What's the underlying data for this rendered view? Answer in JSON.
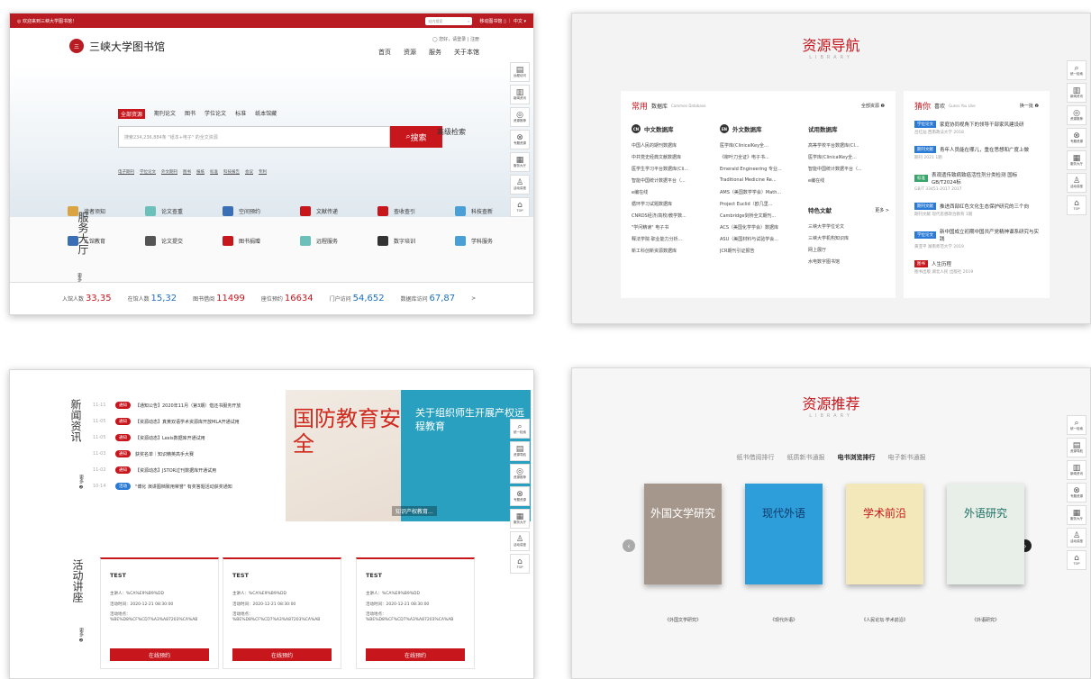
{
  "rail": {
    "p1": [
      {
        "g": "⌕",
        "l": "统一检索",
        "act": true
      },
      {
        "g": "▤",
        "l": "远程访问",
        "act": false
      },
      {
        "g": "▥",
        "l": "新闻资讯",
        "act": false
      },
      {
        "g": "◎",
        "l": "资源推荐",
        "act": false
      },
      {
        "g": "⊗",
        "l": "专题资源",
        "act": false
      },
      {
        "g": "▦",
        "l": "服务大厅",
        "act": false
      },
      {
        "g": "♙",
        "l": "活动讲座",
        "act": false
      },
      {
        "g": "⌂",
        "l": "TOP",
        "act": false
      }
    ],
    "p2": [
      {
        "g": "⌕",
        "l": "统一检索",
        "act": false
      },
      {
        "g": "▤",
        "l": "资源导航",
        "act": true
      },
      {
        "g": "▥",
        "l": "新闻资讯",
        "act": false
      },
      {
        "g": "◎",
        "l": "资源推荐",
        "act": false
      },
      {
        "g": "⊗",
        "l": "专题资源",
        "act": false
      },
      {
        "g": "▦",
        "l": "服务大厅",
        "act": false
      },
      {
        "g": "♙",
        "l": "活动讲座",
        "act": false
      },
      {
        "g": "⌂",
        "l": "TOP",
        "act": false
      }
    ],
    "p3": [
      {
        "g": "⌕",
        "l": "统一检索",
        "act": false
      },
      {
        "g": "▤",
        "l": "资源导航",
        "act": false
      },
      {
        "g": "▥",
        "l": "新闻资讯",
        "act": true
      },
      {
        "g": "◎",
        "l": "资源推荐",
        "act": false
      },
      {
        "g": "⊗",
        "l": "专题资源",
        "act": false
      },
      {
        "g": "▦",
        "l": "服务大厅",
        "act": false
      },
      {
        "g": "♙",
        "l": "活动讲座",
        "act": false
      },
      {
        "g": "⌂",
        "l": "TOP",
        "act": false
      }
    ],
    "p4": [
      {
        "g": "⌕",
        "l": "统一检索",
        "act": false
      },
      {
        "g": "▤",
        "l": "资源导航",
        "act": false
      },
      {
        "g": "▥",
        "l": "新闻资讯",
        "act": false
      },
      {
        "g": "◎",
        "l": "资源推荐",
        "act": true
      },
      {
        "g": "⊗",
        "l": "专题资源",
        "act": false
      },
      {
        "g": "▦",
        "l": "服务大厅",
        "act": false
      },
      {
        "g": "♙",
        "l": "活动讲座",
        "act": false
      },
      {
        "g": "⌂",
        "l": "TOP",
        "act": false
      }
    ]
  },
  "p1": {
    "topbar_left": "◎ 欢迎来到三峡大学图书馆！",
    "topbar_search_placeholder": "站内搜索",
    "topbar_links": "移动图书馆 ▯ ｜ 中文 ▾",
    "logo_text": "三峡大学图书馆",
    "user_line": "◯ 您好，请登录 | 注册",
    "nav": [
      "首页",
      "资源",
      "服务",
      "关于本馆"
    ],
    "search_tabs": [
      "全部资源",
      "期刊论文",
      "图书",
      "学位论文",
      "标准",
      "纸本馆藏"
    ],
    "search_placeholder": "搜索234,236,884条 \"纸本+电子\" 的全文资源",
    "search_button": "搜索",
    "advanced": "高级检索",
    "quick_links": [
      "电子期刊",
      "学位论文",
      "外文期刊",
      "图书",
      "报纸",
      "标准",
      "科技报告",
      "会议",
      "专利"
    ],
    "service_title": "服务大厅",
    "more": "更多 ❷",
    "services": [
      {
        "label": "读者须知",
        "color": "#d9a441"
      },
      {
        "label": "论文查重",
        "color": "#6cc0ba"
      },
      {
        "label": "空间预约",
        "color": "#3a6fb5"
      },
      {
        "label": "文献传递",
        "color": "#c8161d"
      },
      {
        "label": "查收查引",
        "color": "#c8161d"
      },
      {
        "label": "科技查新",
        "color": "#4a9fd6"
      },
      {
        "label": "入馆教育",
        "color": "#3a6fb5"
      },
      {
        "label": "论文提交",
        "color": "#555555"
      },
      {
        "label": "图书捐赠",
        "color": "#c8161d"
      },
      {
        "label": "远程服务",
        "color": "#6cc0ba"
      },
      {
        "label": "数字培训",
        "color": "#333333"
      },
      {
        "label": "学科服务",
        "color": "#4a9fd6"
      }
    ],
    "stats": [
      {
        "label": "入馆人数",
        "value": "33,35",
        "blue": false
      },
      {
        "label": "在馆人数",
        "value": "15,32",
        "blue": true
      },
      {
        "label": "图书借阅",
        "value": "11499",
        "blue": false
      },
      {
        "label": "座位预约",
        "value": "16634",
        "blue": false
      },
      {
        "label": "门户访问",
        "value": "54,652",
        "blue": true
      },
      {
        "label": "数据库访问",
        "value": "67,87",
        "blue": true
      }
    ],
    "stats_arrow": ">"
  },
  "p2": {
    "title": "资源导航",
    "subtitle": "LIBRARY",
    "common_title": "常用",
    "common_sub": "数据库",
    "common_en": "Common Database",
    "common_more": "全部资源 ❷",
    "columns": [
      {
        "badge": "CN",
        "title": "中文数据库",
        "items": [
          "中国人民的期刊数据库",
          "中共党史经典文献数据库",
          "医学生学习平台数据库(Cli...",
          "智能中国统计数据平台（...",
          "e编在线",
          "循环学习试题数据库",
          "CNRDS经济/高校/教学数...",
          "\"学问精读\" 电子书",
          "释法学院·职业能力分析...",
          "新工科创新资源数据库"
        ]
      },
      {
        "badge": "EN",
        "title": "外文数据库",
        "items": [
          "医学库(ClinicalKey全...",
          "《柳叶刀全证》电子书...",
          "Emerald Engineering 专业...",
          "Traditional Medicine Re...",
          "AMS（美国数学学会）Math...",
          "Project Euclid（欧几里...",
          "Cambridge剑桥全文期刊...",
          "ACS（美国化学学会）数据库",
          "ASU（美国材料与试验学会...",
          "JCR期刊引证报告"
        ]
      },
      {
        "badge": "",
        "title": "试用数据库",
        "items": [
          "高等学校平台数据库(Cl...",
          "医学库(ClinicalKey全...",
          "智能中国统计数据平台（...",
          "e编在线"
        ]
      }
    ],
    "special_title": "特色文献",
    "special_more": "更多 >",
    "special_items": [
      "三峡大学学位论文",
      "三峡大学机构知识库",
      "网上展厅",
      "水电数字图书馆"
    ],
    "rec_title": "猜你",
    "rec_sub": "喜欢",
    "rec_en": "Guess You Like",
    "rec_more": "换一批 ❷",
    "recs": [
      {
        "tag": "学位论文",
        "color": "#2b7bd6",
        "title": "家庭协同视角下的领导干部家风建设研",
        "sub": "吕红灿 西南政法大学 2018"
      },
      {
        "tag": "期刊文献",
        "color": "#2b7bd6",
        "title": "青年人员能在哪儿，重在思想和广度上做",
        "sub": "期刊 2021 1期"
      },
      {
        "tag": "标准",
        "color": "#3aa56a",
        "title": "表观遗传致病致癌活性剂分类检测 国标GB/T2024标",
        "sub": "GB/T 33451-2017 2017"
      },
      {
        "tag": "期刊文献",
        "color": "#2b7bd6",
        "title": "推进西部红色文化生态保护研究的三个向",
        "sub": "期刊文献 现代思想政治教育 1期"
      },
      {
        "tag": "学位论文",
        "color": "#2b7bd6",
        "title": "新中国成立初期中国共产党精神谱系研究与实践",
        "sub": "黄亚平 湖南师范大学 2019"
      },
      {
        "tag": "图书",
        "color": "#c8161d",
        "title": "人生历程",
        "sub": "图书出版 湖北人民 出版社 2019"
      }
    ]
  },
  "p3": {
    "news_title": "新闻资讯",
    "more": "更多 ❷",
    "news": [
      {
        "date": "11-11",
        "tag": "通知",
        "color": "#c8161d",
        "text": "【通知公告】2020年11月（第3期）借还书服务开放"
      },
      {
        "date": "11-05",
        "tag": "通知",
        "color": "#c8161d",
        "text": "【资源动态】真黄双语学术资源库开放MLA开通试用"
      },
      {
        "date": "11-05",
        "tag": "通知",
        "color": "#c8161d",
        "text": "【资源动态】Lexis数据库开通试用"
      },
      {
        "date": "11-03",
        "tag": "通知",
        "color": "#c8161d",
        "text": "获奖名单｜知识精英高手大赛"
      },
      {
        "date": "11-02",
        "tag": "通知",
        "color": "#c8161d",
        "text": "【资源动态】JSTOR过刊数据库开通试用"
      },
      {
        "date": "10-14",
        "tag": "活动",
        "color": "#2b7bd6",
        "text": "\"博化 演讲图档致用荣誉\" 有奖答题活动获奖通知"
      }
    ],
    "banner_left": "国防教育安全",
    "banner_right": "关于组织师生开展产权远程教育",
    "banner_caption": "知识产权教育...",
    "activity_title": "活动讲座",
    "acards": [
      {
        "title": "TEST",
        "speaker": "主讲人：%CA%E9%B9%DD",
        "time": "活动时间：2020-12-21 08:30:00",
        "place": "活动地点：%BE%D8%CF%CD7%A3%A87203%CA%AB",
        "btn": "在线预约"
      },
      {
        "title": "TEST",
        "speaker": "主讲人：%CA%E9%B9%DD",
        "time": "活动时间：2020-12-21 08:30:00",
        "place": "活动地点：%BE%D8%CF%CD7%A3%A87203%CA%AB",
        "btn": "在线预约"
      },
      {
        "title": "TEST",
        "speaker": "主讲人：%CA%E9%B9%DD",
        "time": "活动时间：2020-12-21 08:30:00",
        "place": "活动地点：%BE%D8%CF%CD7%A3%A87203%CA%AB",
        "btn": "在线预约"
      }
    ]
  },
  "p4": {
    "title": "资源推荐",
    "subtitle": "LIBRARY",
    "tabs": [
      {
        "label": "纸书借阅排行",
        "on": false
      },
      {
        "label": "纸质新书通报",
        "on": false
      },
      {
        "label": "电书浏览排行",
        "on": true
      },
      {
        "label": "电子新书通报",
        "on": false
      }
    ],
    "books": [
      {
        "cover": "外国文学研究",
        "bg": "#a6978d",
        "fg": "#ffffff",
        "caption": "《外国文学研究》"
      },
      {
        "cover": "现代外语",
        "bg": "#2d9ed9",
        "fg": "#0f3a6b",
        "caption": "《现代外语》"
      },
      {
        "cover": "学术前沿",
        "bg": "#f2e8b9",
        "fg": "#c8161d",
        "caption": "《人民论坛·学术前沿》"
      },
      {
        "cover": "外语研究",
        "bg": "#e8efe9",
        "fg": "#1a6f62",
        "caption": "《外语研究》"
      }
    ]
  }
}
